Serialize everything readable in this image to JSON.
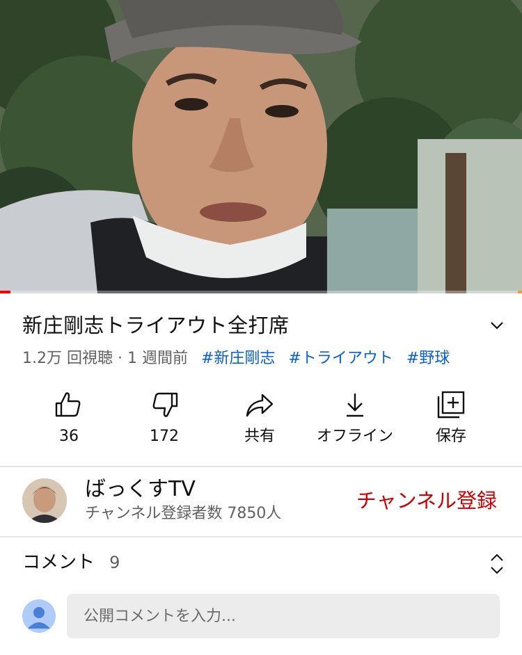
{
  "video": {
    "title": "新庄剛志トライアウト全打席",
    "meta": "1.2万 回視聴 · 1 週間前",
    "hashtags": [
      "#新庄剛志",
      "#トライアウト",
      "#野球"
    ],
    "progress_fraction": 0.02
  },
  "actions": {
    "like_count": "36",
    "dislike_count": "172",
    "share_label": "共有",
    "offline_label": "オフライン",
    "save_label": "保存"
  },
  "channel": {
    "name": "ばっくすTV",
    "subscribers": "チャンネル登録者数 7850人",
    "subscribe_label": "チャンネル登録"
  },
  "comments": {
    "label": "コメント",
    "count": "9",
    "input_placeholder": "公開コメントを入力..."
  },
  "colors": {
    "accent": "#cc0000",
    "hashtag": "#065fd4",
    "progress": "#ff0000",
    "secondary_text": "#606060"
  },
  "icons": {
    "expand": "chevron-down-icon",
    "like": "thumbs-up-icon",
    "dislike": "thumbs-down-icon",
    "share": "share-arrow-icon",
    "offline": "download-icon",
    "save": "add-to-playlist-icon",
    "sort": "sort-icon",
    "user": "user-avatar-icon"
  }
}
